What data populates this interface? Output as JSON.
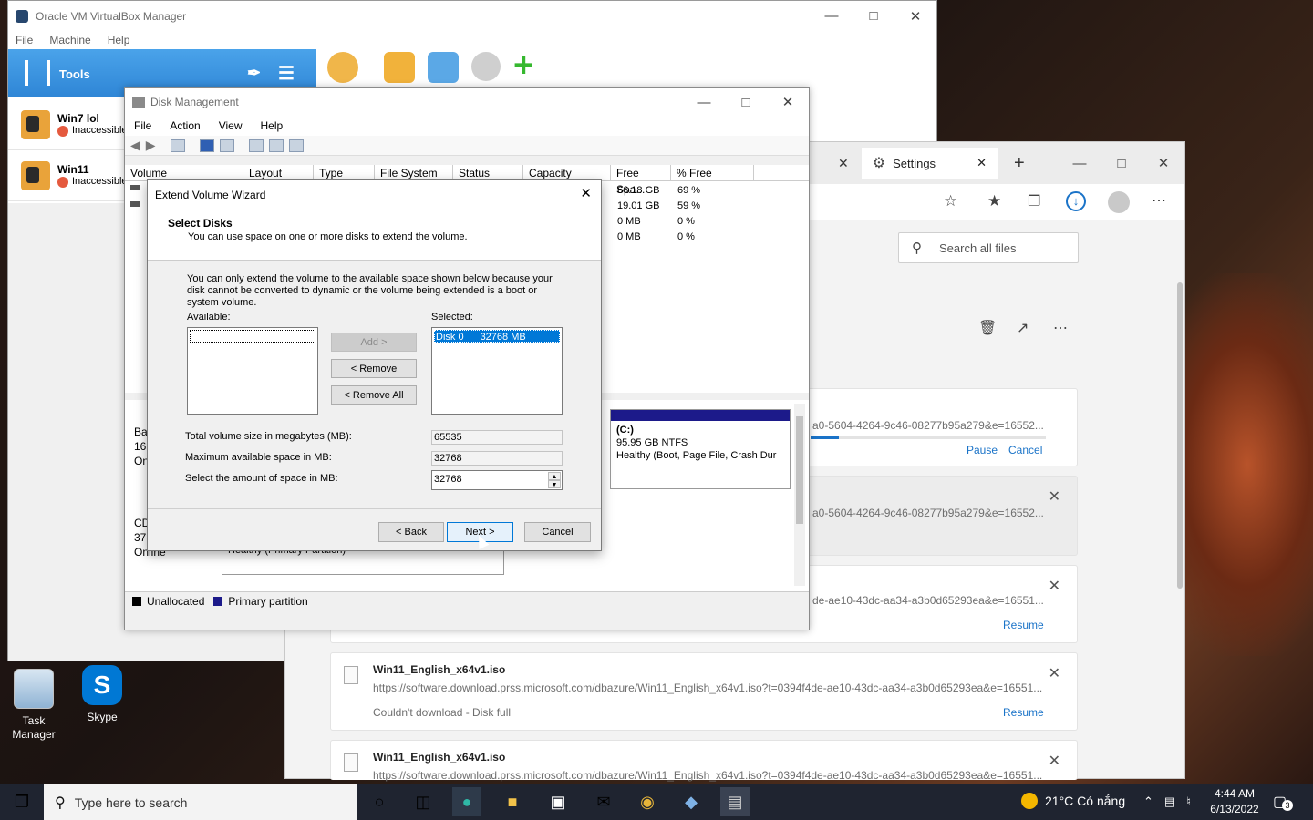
{
  "virtualbox": {
    "title": "Oracle VM VirtualBox Manager",
    "menu": [
      "File",
      "Machine",
      "Help"
    ],
    "tools_label": "Tools",
    "vms": [
      {
        "name": "Win7 lol",
        "status": "Inaccessible"
      },
      {
        "name": "Win11",
        "status": "Inaccessible"
      }
    ]
  },
  "edge": {
    "settings_tab": "Settings",
    "search_placeholder": "Search all files",
    "downloads": [
      {
        "title": "",
        "url": "a0-5604-4264-9c46-08277b95a279&e=16552...",
        "status": "",
        "actions": [
          "Pause",
          "Cancel"
        ]
      },
      {
        "title": "",
        "url": "a0-5604-4264-9c46-08277b95a279&e=16552...",
        "status": "",
        "actions": []
      },
      {
        "title": "",
        "url": "de-ae10-43dc-aa34-a3b0d65293ea&e=16551...",
        "status": "",
        "actions": [
          "Resume"
        ]
      },
      {
        "title": "Win11_English_x64v1.iso",
        "url": "https://software.download.prss.microsoft.com/dbazure/Win11_English_x64v1.iso?t=0394f4de-ae10-43dc-aa34-a3b0d65293ea&e=16551...",
        "status": "Couldn't download - Disk full",
        "actions": [
          "Resume"
        ]
      },
      {
        "title": "Win11_English_x64v1.iso",
        "url": "https://software.download.prss.microsoft.com/dbazure/Win11_English_x64v1.iso?t=0394f4de-ae10-43dc-aa34-a3b0d65293ea&e=16551...",
        "status": "",
        "actions": []
      }
    ]
  },
  "disk_management": {
    "title": "Disk Management",
    "menu": [
      "File",
      "Action",
      "View",
      "Help"
    ],
    "columns": [
      "Volume",
      "Layout",
      "Type",
      "File System",
      "Status",
      "Capacity",
      "Free Spa...",
      "% Free"
    ],
    "free_space": [
      "66.18 GB",
      "19.01 GB",
      "0 MB",
      "0 MB"
    ],
    "pct_free": [
      "69 %",
      "59 %",
      "0 %",
      "0 %"
    ],
    "partition_c": {
      "label": "(C:)",
      "size": "95.95 GB NTFS",
      "status": "Healthy (Boot, Page File, Crash Dur"
    },
    "partial_status": "Healthy (Primary Partition)",
    "disk_info_left": [
      "Ba",
      "16(",
      "On",
      "CD",
      "37(",
      "Online"
    ],
    "legend": [
      "Unallocated",
      "Primary partition"
    ]
  },
  "wizard": {
    "title": "Extend Volume Wizard",
    "heading": "Select Disks",
    "subheading": "You can use space on one or more disks to extend the volume.",
    "info": "You can only extend the volume to the available space shown below because your disk cannot be converted to dynamic or the volume being extended is a boot or system volume.",
    "available_label": "Available:",
    "selected_label": "Selected:",
    "selected_item_disk": "Disk 0",
    "selected_item_size": "32768 MB",
    "add_btn": "Add >",
    "remove_btn": "< Remove",
    "remove_all_btn": "< Remove All",
    "total_label": "Total volume size in megabytes (MB):",
    "total_value": "65535",
    "max_label": "Maximum available space in MB:",
    "max_value": "32768",
    "amount_label": "Select the amount of space in MB:",
    "amount_value": "32768",
    "back_btn": "< Back",
    "next_btn": "Next >",
    "cancel_btn": "Cancel"
  },
  "desktop_icons": [
    {
      "label": "Task Manager"
    },
    {
      "label": "Skype"
    }
  ],
  "taskbar": {
    "search_placeholder": "Type here to search",
    "weather": "21°C  Có nắng",
    "time": "4:44 AM",
    "date": "6/13/2022",
    "notifications": "3"
  }
}
